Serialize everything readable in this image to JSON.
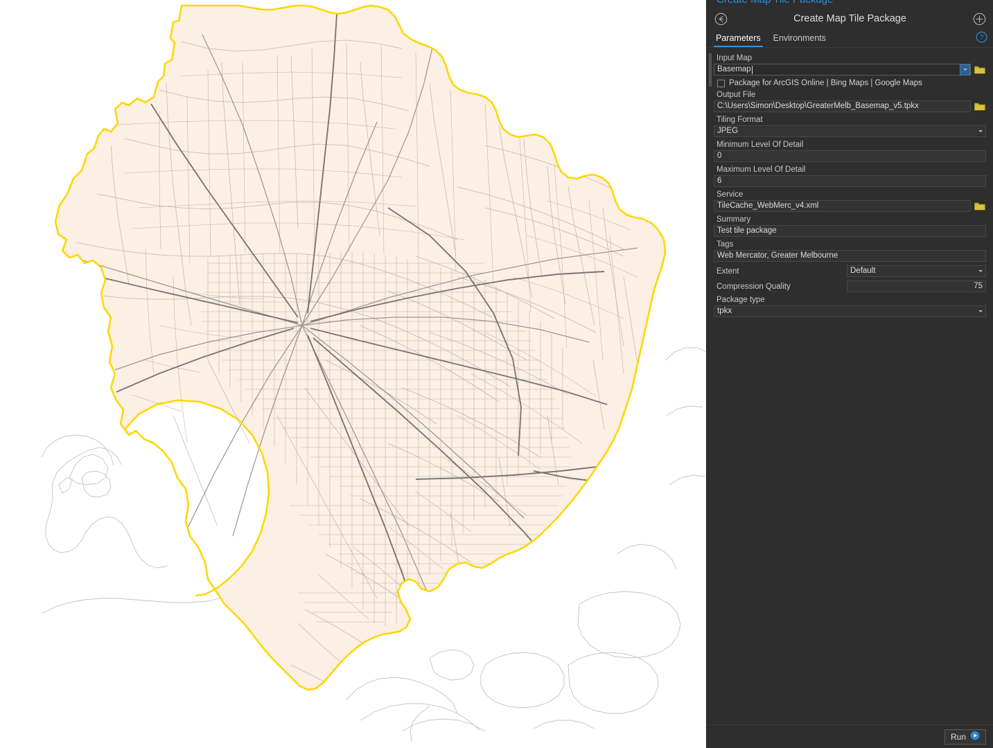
{
  "window": {
    "clipped_top_text": "Create Map Tile Package"
  },
  "pane": {
    "title": "Create Map Tile Package",
    "back_icon": "back-arrow-circle-icon",
    "add_icon": "plus-circle-icon",
    "help_icon": "help-circle-icon",
    "tabs": [
      {
        "label": "Parameters",
        "active": true
      },
      {
        "label": "Environments",
        "active": false
      }
    ],
    "footer": {
      "run_label": "Run",
      "run_icon": "play-circle-icon"
    }
  },
  "parameters": {
    "input_map": {
      "label": "Input Map",
      "value": "Basemap",
      "has_caret": true,
      "dropdown_icon": "chevron-down-icon",
      "browse_icon": "folder-icon"
    },
    "package_for_online": {
      "label": "Package for ArcGIS Online | Bing Maps | Google Maps",
      "checked": false
    },
    "output_file": {
      "label": "Output File",
      "value": "C:\\Users\\Simon\\Desktop\\GreaterMelb_Basemap_v5.tpkx",
      "browse_icon": "folder-icon"
    },
    "tiling_format": {
      "label": "Tiling Format",
      "value": "JPEG",
      "dropdown_icon": "chevron-down-icon"
    },
    "minimum_level_of_detail": {
      "label": "Minimum Level Of Detail",
      "value": "0"
    },
    "maximum_level_of_detail": {
      "label": "Maximum Level Of Detail",
      "value": "6"
    },
    "service": {
      "label": "Service",
      "value": "TileCache_WebMerc_v4.xml",
      "browse_icon": "folder-icon"
    },
    "summary": {
      "label": "Summary",
      "value": "Test tile package"
    },
    "tags": {
      "label": "Tags",
      "value": "Web Mercator, Greater Melbourne"
    },
    "extent": {
      "label": "Extent",
      "value": "Default",
      "dropdown_icon": "chevron-down-icon"
    },
    "compression_quality": {
      "label": "Compression Quality",
      "value": "75"
    },
    "package_type": {
      "label": "Package type",
      "value": "tpkx",
      "dropdown_icon": "chevron-down-icon"
    }
  },
  "map": {
    "name": "Greater Melbourne basemap",
    "colors": {
      "water": "#ffffff",
      "land_fill": "#fbf0e3",
      "boundary_highlight": "#ffd700",
      "subdivision_line": "#b8b3ad",
      "road_minor": "#b5b0ab",
      "road_major": "#8e8a86",
      "road_freeway": "#6f6b68"
    }
  },
  "theme": {
    "pane_background": "#2e2e2e",
    "field_background": "#333333",
    "field_border": "#474747",
    "accent_blue": "#3a8fd4",
    "folder_yellow": "#c9b22e",
    "text_primary": "#dcdcdc",
    "text_label": "#c8c8c8"
  }
}
